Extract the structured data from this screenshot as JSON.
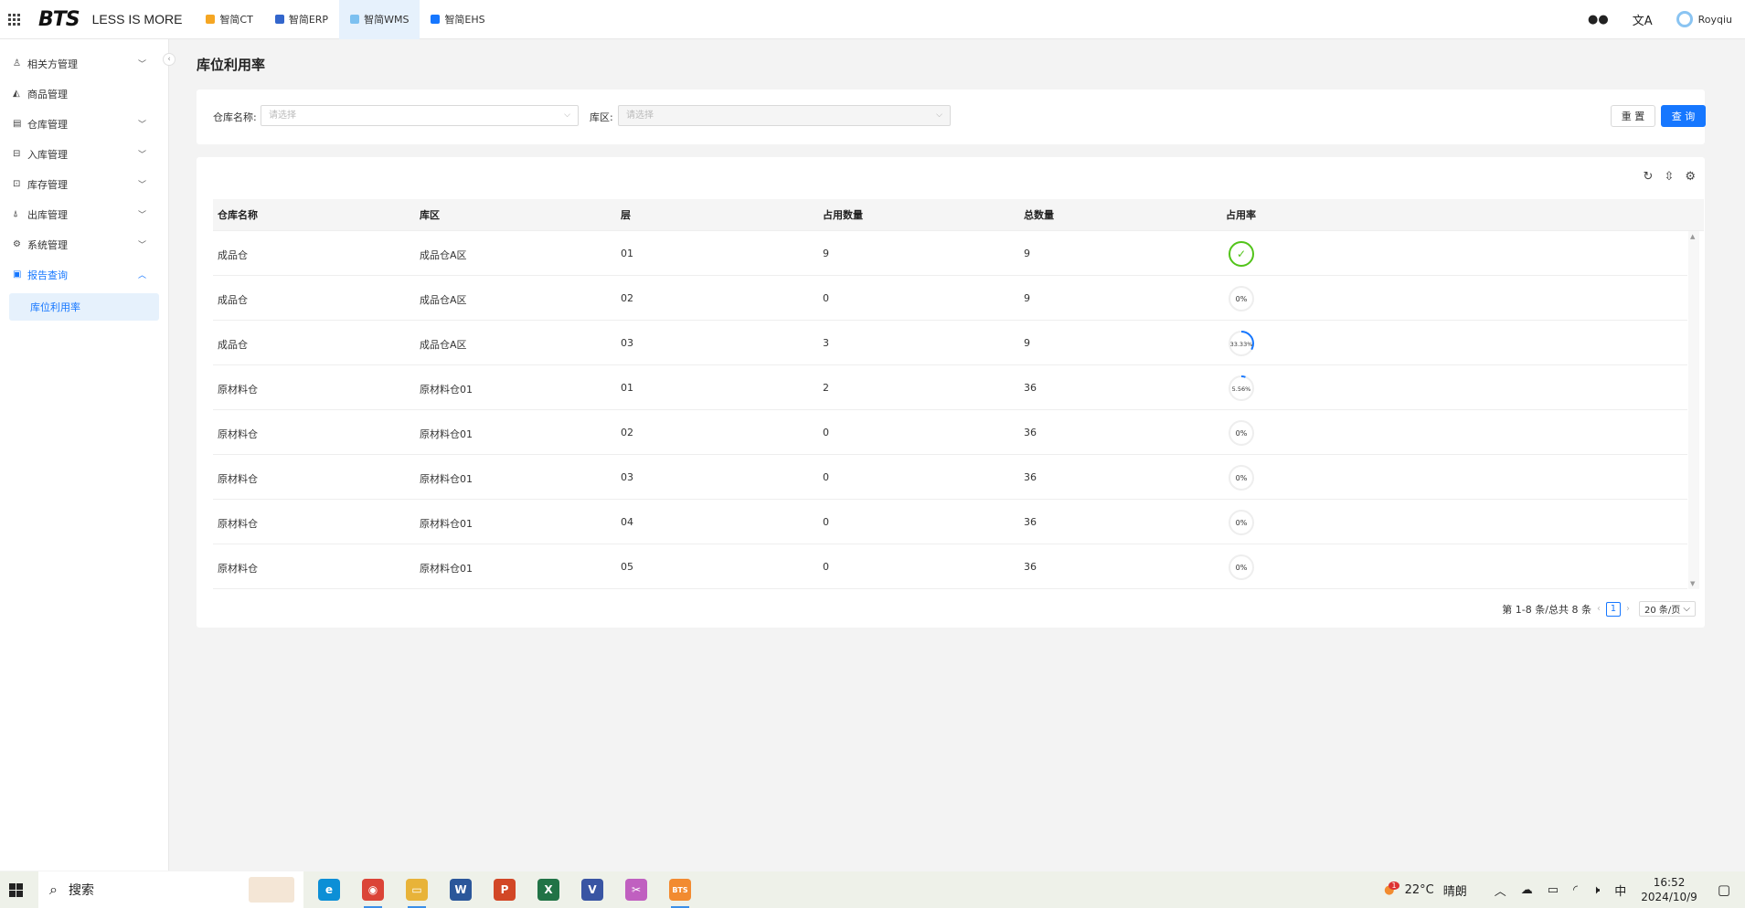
{
  "topbar": {
    "logo": "BTS",
    "slogan": "LESS IS MORE",
    "app_tabs": [
      {
        "label": "智简CT",
        "color": "#f5a623",
        "active": false
      },
      {
        "label": "智简ERP",
        "color": "#3366cc",
        "active": false
      },
      {
        "label": "智简WMS",
        "color": "#7cc0f0",
        "active": true
      },
      {
        "label": "智简EHS",
        "color": "#1677ff",
        "active": false
      }
    ],
    "user_name": "Royqiu"
  },
  "sidebar": {
    "items": [
      {
        "label": "相关方管理",
        "icon": "user-icon",
        "glyph": "♙",
        "chevron": true,
        "open": false
      },
      {
        "label": "商品管理",
        "icon": "product-icon",
        "glyph": "◭",
        "chevron": false,
        "open": false
      },
      {
        "label": "仓库管理",
        "icon": "warehouse-icon",
        "glyph": "▤",
        "chevron": true,
        "open": false
      },
      {
        "label": "入库管理",
        "icon": "inbound-icon",
        "glyph": "⊟",
        "chevron": true,
        "open": false
      },
      {
        "label": "库存管理",
        "icon": "inventory-icon",
        "glyph": "⊡",
        "chevron": true,
        "open": false
      },
      {
        "label": "出库管理",
        "icon": "outbound-icon",
        "glyph": "⍋",
        "chevron": true,
        "open": false
      },
      {
        "label": "系统管理",
        "icon": "settings-icon",
        "glyph": "⚙",
        "chevron": true,
        "open": false
      },
      {
        "label": "报告查询",
        "icon": "report-icon",
        "glyph": "▣",
        "chevron": true,
        "open": true
      }
    ],
    "sub_item": "库位利用率"
  },
  "page": {
    "title": "库位利用率"
  },
  "filters": {
    "warehouse_label": "仓库名称:",
    "warehouse_placeholder": "请选择",
    "zone_label": "库区:",
    "zone_placeholder": "请选择",
    "reset_label": "重 置",
    "query_label": "查 询"
  },
  "table": {
    "columns": [
      "仓库名称",
      "库区",
      "层",
      "占用数量",
      "总数量",
      "占用率"
    ],
    "rows": [
      {
        "warehouse": "成品仓",
        "zone": "成品仓A区",
        "layer": "01",
        "used": "9",
        "total": "9",
        "rate": 100,
        "rate_label": "✓"
      },
      {
        "warehouse": "成品仓",
        "zone": "成品仓A区",
        "layer": "02",
        "used": "0",
        "total": "9",
        "rate": 0,
        "rate_label": "0%"
      },
      {
        "warehouse": "成品仓",
        "zone": "成品仓A区",
        "layer": "03",
        "used": "3",
        "total": "9",
        "rate": 33.33,
        "rate_label": "33.33%"
      },
      {
        "warehouse": "原材料仓",
        "zone": "原材料仓01",
        "layer": "01",
        "used": "2",
        "total": "36",
        "rate": 5.56,
        "rate_label": "5.56%"
      },
      {
        "warehouse": "原材料仓",
        "zone": "原材料仓01",
        "layer": "02",
        "used": "0",
        "total": "36",
        "rate": 0,
        "rate_label": "0%"
      },
      {
        "warehouse": "原材料仓",
        "zone": "原材料仓01",
        "layer": "03",
        "used": "0",
        "total": "36",
        "rate": 0,
        "rate_label": "0%"
      },
      {
        "warehouse": "原材料仓",
        "zone": "原材料仓01",
        "layer": "04",
        "used": "0",
        "total": "36",
        "rate": 0,
        "rate_label": "0%"
      },
      {
        "warehouse": "原材料仓",
        "zone": "原材料仓01",
        "layer": "05",
        "used": "0",
        "total": "36",
        "rate": 0,
        "rate_label": "0%"
      }
    ],
    "pagination": {
      "summary": "第 1-8 条/总共 8 条",
      "current_page": "1",
      "page_size": "20 条/页"
    }
  },
  "colors": {
    "accent": "#1677ff",
    "complete": "#52c41a",
    "track": "#eeeeee"
  },
  "taskbar": {
    "search_text": "搜索",
    "apps": [
      {
        "name": "edge-icon",
        "glyph": "e",
        "color": "#0c8fd6",
        "running": false
      },
      {
        "name": "chrome-icon",
        "glyph": "◉",
        "color": "#db4437",
        "running": true
      },
      {
        "name": "file-explorer-icon",
        "glyph": "▭",
        "color": "#e8b339",
        "running": true
      },
      {
        "name": "word-icon",
        "glyph": "W",
        "color": "#2b579a",
        "running": false
      },
      {
        "name": "powerpoint-icon",
        "glyph": "P",
        "color": "#d24726",
        "running": false
      },
      {
        "name": "excel-icon",
        "glyph": "X",
        "color": "#217346",
        "running": false
      },
      {
        "name": "visio-icon",
        "glyph": "V",
        "color": "#3955a3",
        "running": false
      },
      {
        "name": "snipping-tool-icon",
        "glyph": "✂",
        "color": "#c060c0",
        "running": false
      },
      {
        "name": "bts-app-icon",
        "glyph": "BTS",
        "color": "#f28b30",
        "running": true
      }
    ],
    "weather_temp": "22°C",
    "weather_desc": "晴朗",
    "weather_badge": "1",
    "ime": "中",
    "time": "16:52",
    "date": "2024/10/9"
  }
}
